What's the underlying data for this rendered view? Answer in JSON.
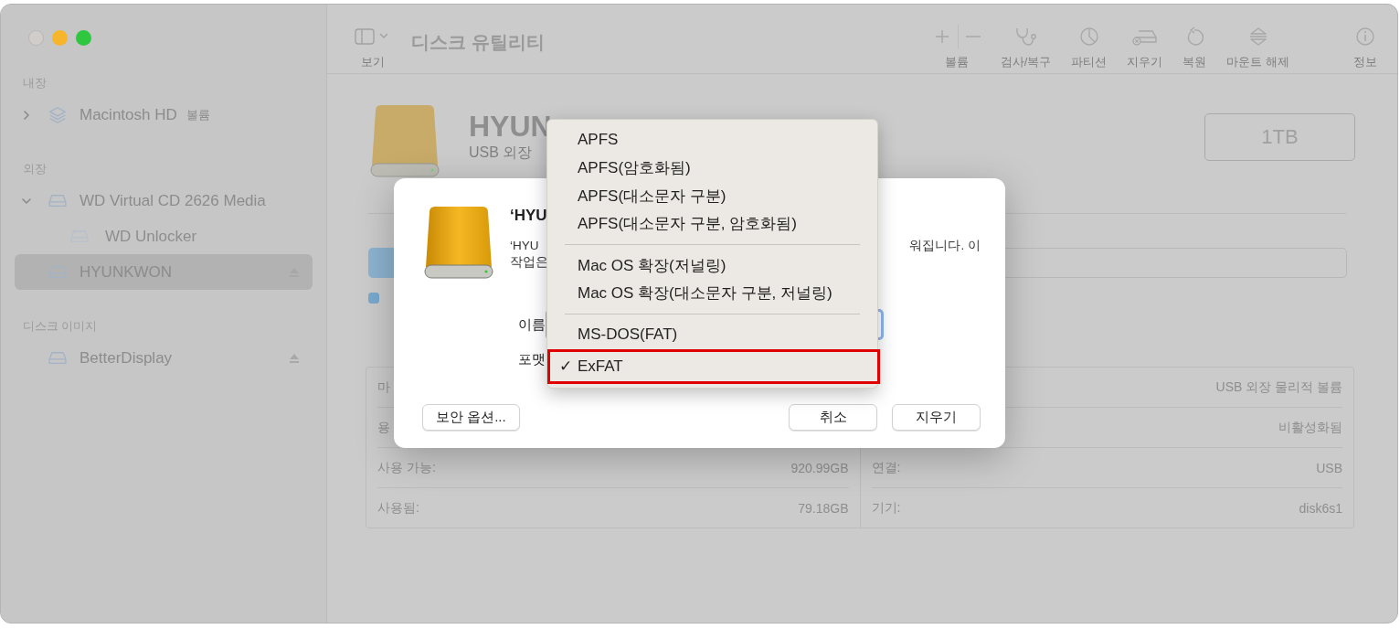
{
  "toolbar": {
    "view_label": "보기",
    "title": "디스크 유틸리티",
    "tools": [
      {
        "kind": "volume",
        "label": "볼륨"
      },
      {
        "kind": "check",
        "label": "검사/복구"
      },
      {
        "kind": "partition",
        "label": "파티션"
      },
      {
        "kind": "erase",
        "label": "지우기"
      },
      {
        "kind": "restore",
        "label": "복원"
      },
      {
        "kind": "unmount",
        "label": "마운트 해제"
      },
      {
        "kind": "info",
        "label": "정보"
      }
    ]
  },
  "sidebar": {
    "sections": [
      {
        "title": "내장",
        "items": [
          {
            "name": "Macintosh HD",
            "tag": "볼륨",
            "kind": "volume",
            "expanded": false,
            "selected": false,
            "eject": false
          }
        ]
      },
      {
        "title": "외장",
        "items": [
          {
            "name": "WD Virtual CD 2626 Media",
            "kind": "disk",
            "expanded": true,
            "selected": false,
            "eject": false,
            "children": [
              {
                "name": "WD Unlocker",
                "kind": "disk",
                "selected": false,
                "eject": false
              }
            ]
          },
          {
            "name": "HYUNKWON",
            "kind": "disk",
            "selected": true,
            "eject": true
          }
        ]
      },
      {
        "title": "디스크 이미지",
        "items": [
          {
            "name": "BetterDisplay",
            "kind": "disk",
            "selected": false,
            "eject": true
          }
        ]
      }
    ]
  },
  "disk": {
    "name": "HYUN",
    "subtitle": "USB 외장",
    "capacity": "1TB"
  },
  "options_checkbox": {
    "checked": true
  },
  "info": {
    "left": [
      {
        "label": "마"
      },
      {
        "label": "용"
      },
      {
        "label": "사용 가능:",
        "value": "920.99GB"
      },
      {
        "label": "사용됨:",
        "value": "79.18GB"
      }
    ],
    "right": [
      {
        "value": "USB 외장 물리적 볼륨"
      },
      {
        "value": "비활성화됨"
      },
      {
        "label": "연결:",
        "value": "USB"
      },
      {
        "label": "기기:",
        "value": "disk6s1"
      }
    ]
  },
  "dialog": {
    "title": "‘HYU",
    "message_start": [
      "‘HYU",
      "작업은"
    ],
    "message_end": "워집니다. 이",
    "name_label": "이름",
    "format_label": "포맷",
    "security_button": "보안 옵션...",
    "buttons": [
      "취소",
      "지우기"
    ]
  },
  "menu": {
    "check_glyph": "✓",
    "sections": [
      {
        "items": [
          {
            "label": "APFS",
            "checked": false,
            "highlighted": false
          },
          {
            "label": "APFS(암호화됨)",
            "checked": false,
            "highlighted": false
          },
          {
            "label": "APFS(대소문자 구분)",
            "checked": false,
            "highlighted": false
          },
          {
            "label": "APFS(대소문자 구분, 암호화됨)",
            "checked": false,
            "highlighted": false
          }
        ]
      },
      {
        "items": [
          {
            "label": "Mac OS 확장(저널링)",
            "checked": false,
            "highlighted": false
          },
          {
            "label": "Mac OS 확장(대소문자 구분, 저널링)",
            "checked": false,
            "highlighted": false
          }
        ]
      },
      {
        "items": [
          {
            "label": "MS-DOS(FAT)",
            "checked": false,
            "highlighted": false
          },
          {
            "label": "ExFAT",
            "checked": true,
            "highlighted": true
          }
        ]
      }
    ]
  }
}
